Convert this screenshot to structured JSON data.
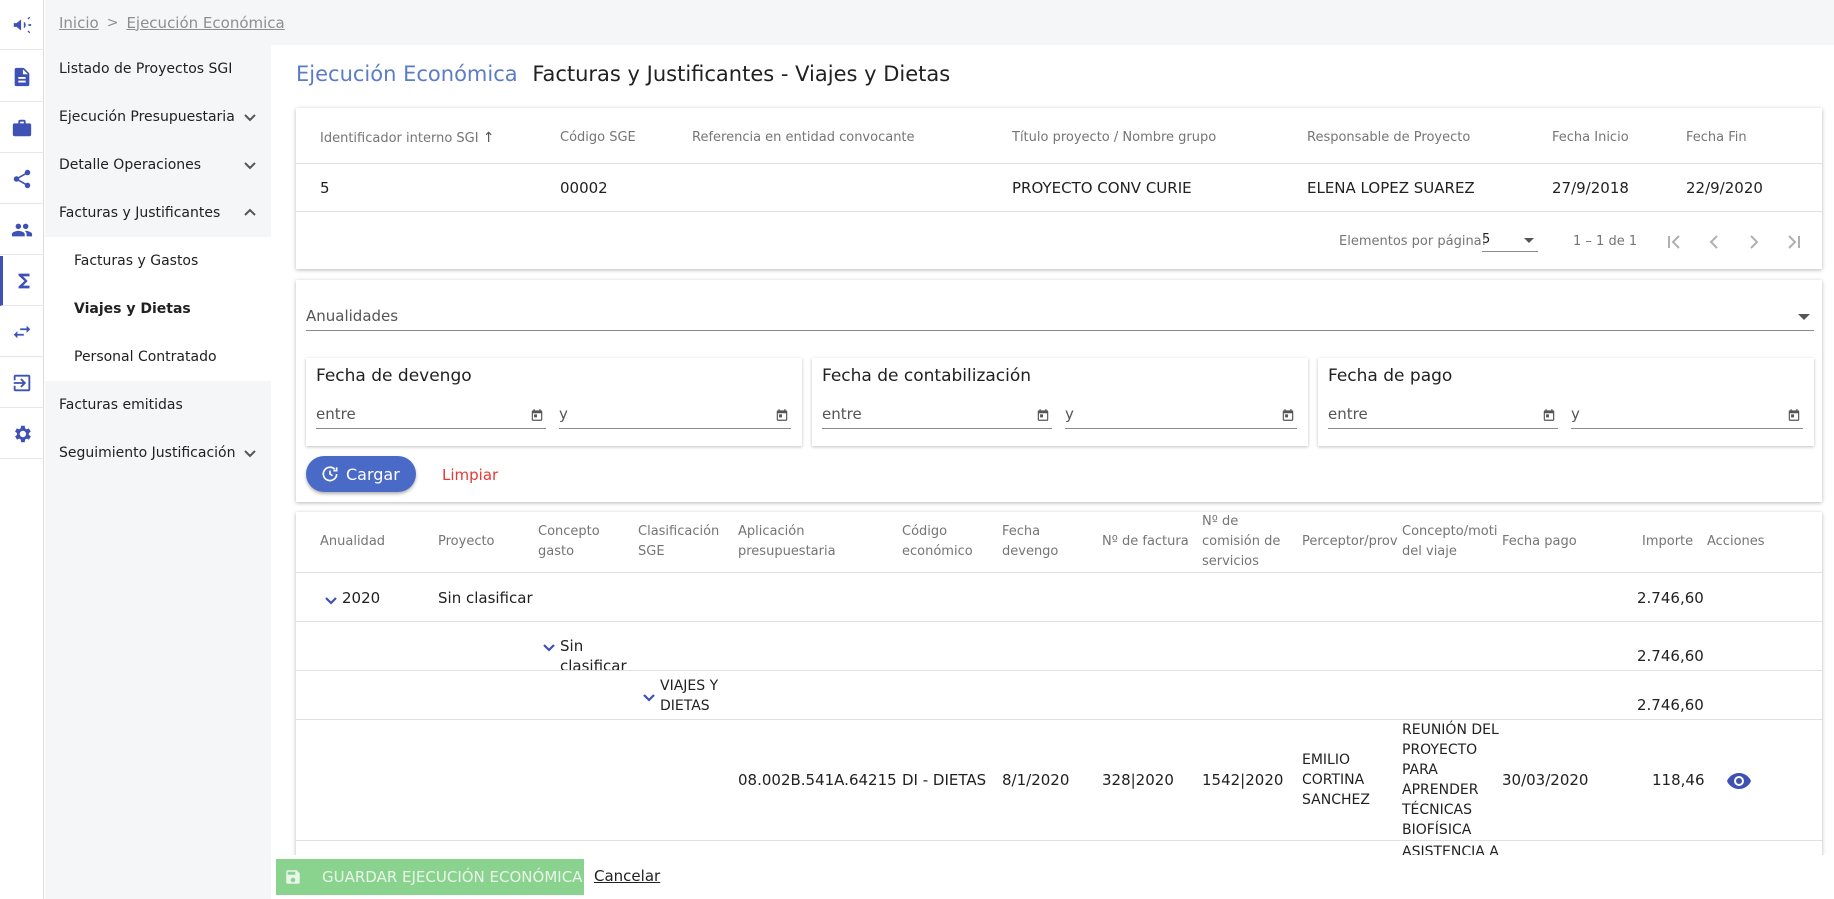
{
  "rail": {
    "icons": [
      "megaphone-icon",
      "document-icon",
      "briefcase-icon",
      "share-icon",
      "people-icon",
      "sigma-icon",
      "swap-icon",
      "logout-icon",
      "gear-icon"
    ]
  },
  "breadcrumb": {
    "home": "Inicio",
    "separator": ">",
    "current": "Ejecución Económica"
  },
  "submenu": {
    "items": [
      {
        "label": "Listado de Proyectos SGI"
      },
      {
        "label": "Ejecución Presupuestaria"
      },
      {
        "label": "Detalle Operaciones"
      },
      {
        "label": "Facturas y Justificantes"
      },
      {
        "label": "Facturas y Gastos"
      },
      {
        "label": "Viajes y Dietas"
      },
      {
        "label": "Personal Contratado"
      },
      {
        "label": "Facturas emitidas"
      },
      {
        "label": "Seguimiento Justificación"
      }
    ]
  },
  "page": {
    "title_section": "Ejecución Económica",
    "title_main": "Facturas y Justificantes - Viajes y Dietas"
  },
  "project_table": {
    "headers": [
      "Identificador interno SGI",
      "Código SGE",
      "Referencia en entidad convocante",
      "Título proyecto / Nombre grupo",
      "Responsable de Proyecto",
      "Fecha Inicio",
      "Fecha Fin"
    ],
    "row": [
      "5",
      "00002",
      "",
      "PROYECTO CONV CURIE",
      "ELENA LOPEZ SUAREZ",
      "27/9/2018",
      "22/9/2020"
    ],
    "page_size_label": "Elementos por página:",
    "page_size": "5",
    "range": "1 – 1 de 1"
  },
  "filters": {
    "anualidades": "Anualidades",
    "boxes": [
      {
        "title": "Fecha de devengo",
        "from": "entre",
        "to": "y"
      },
      {
        "title": "Fecha de contabilización",
        "from": "entre",
        "to": "y"
      },
      {
        "title": "Fecha de pago",
        "from": "entre",
        "to": "y"
      }
    ],
    "load_label": "Cargar",
    "clear_label": "Limpiar"
  },
  "data_table": {
    "headers": {
      "anualidad": "Anualidad",
      "proyecto": "Proyecto",
      "concepto_1": "Concepto",
      "concepto_2": "gasto",
      "clasif_1": "Clasificación",
      "clasif_2": "SGE",
      "aplic_1": "Aplicación",
      "aplic_2": "presupuestaria",
      "codigo_1": "Código",
      "codigo_2": "económico",
      "fecha_dev_1": "Fecha",
      "fecha_dev_2": "devengo",
      "factura": "Nº de factura",
      "comision_1": "Nº de",
      "comision_2": "comisión de",
      "comision_3": "servicios",
      "perceptor": "Perceptor/prove",
      "motivo_1": "Concepto/motiv",
      "motivo_2": "del viaje",
      "fecha_pago": "Fecha pago",
      "importe": "Importe",
      "acciones": "Acciones"
    },
    "group_year": {
      "year": "2020",
      "proyecto": "Sin clasificar",
      "importe": "2.746,60"
    },
    "group_concept": {
      "line1": "Sin",
      "line2": "clasificar",
      "importe": "2.746,60"
    },
    "group_clasif": {
      "line1": "VIAJES Y",
      "line2": "DIETAS",
      "importe": "2.746,60"
    },
    "detail_row": {
      "aplicacion": "08.002B.541A.64215",
      "codigo": "DI - DIETAS",
      "fecha_devengo": "8/1/2020",
      "factura": "328|2020",
      "comision": "1542|2020",
      "perceptor": [
        "EMILIO",
        "CORTINA",
        "SANCHEZ"
      ],
      "motivo": [
        "REUNIÓN DEL",
        "PROYECTO",
        "PARA",
        "APRENDER",
        "TÉCNICAS",
        "BIOFÍSICA"
      ],
      "fecha_pago": "30/03/2020",
      "importe": "118,46"
    },
    "next_row_partial": "ASISTENCIA A"
  },
  "footer": {
    "save_label": "GUARDAR EJECUCIÓN ECONÓMICA",
    "cancel_label": "Cancelar"
  },
  "colors": {
    "accent": "#3f51b5",
    "title_accent": "#5c7cc7",
    "load_button": "#4a6ac7",
    "save_button_disabled": "#8ad38e",
    "clear_text": "#e53935",
    "menu_bg": "#f5f6f8"
  }
}
